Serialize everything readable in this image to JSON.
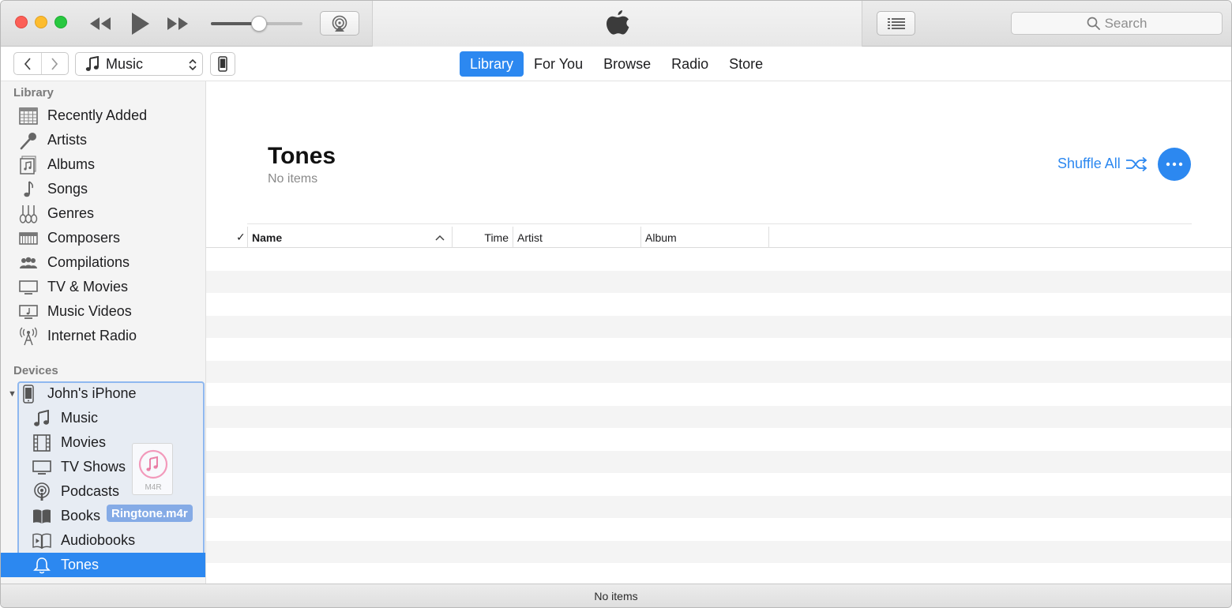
{
  "titlebar": {
    "search_placeholder": "Search"
  },
  "navbar": {
    "media_kind": "Music",
    "tabs": [
      {
        "label": "Library",
        "active": true
      },
      {
        "label": "For You",
        "active": false
      },
      {
        "label": "Browse",
        "active": false
      },
      {
        "label": "Radio",
        "active": false
      },
      {
        "label": "Store",
        "active": false
      }
    ]
  },
  "sidebar": {
    "library_heading": "Library",
    "library_items": [
      {
        "label": "Recently Added",
        "icon": "grid-calendar-icon"
      },
      {
        "label": "Artists",
        "icon": "microphone-icon"
      },
      {
        "label": "Albums",
        "icon": "album-icon"
      },
      {
        "label": "Songs",
        "icon": "music-note-icon"
      },
      {
        "label": "Genres",
        "icon": "guitars-icon"
      },
      {
        "label": "Composers",
        "icon": "piano-icon"
      },
      {
        "label": "Compilations",
        "icon": "people-icon"
      },
      {
        "label": "TV & Movies",
        "icon": "tv-icon"
      },
      {
        "label": "Music Videos",
        "icon": "music-video-icon"
      },
      {
        "label": "Internet Radio",
        "icon": "antenna-icon"
      }
    ],
    "devices_heading": "Devices",
    "device_name": "John's iPhone",
    "device_items": [
      {
        "label": "Music",
        "icon": "music-note-icon"
      },
      {
        "label": "Movies",
        "icon": "film-icon"
      },
      {
        "label": "TV Shows",
        "icon": "tv-icon"
      },
      {
        "label": "Podcasts",
        "icon": "podcast-icon"
      },
      {
        "label": "Books",
        "icon": "book-icon"
      },
      {
        "label": "Audiobooks",
        "icon": "audiobook-icon"
      },
      {
        "label": "Tones",
        "icon": "bell-icon",
        "selected": true
      }
    ],
    "drag_file_ext": "M4R",
    "drag_file_name": "Ringtone.m4r"
  },
  "main": {
    "title": "Tones",
    "subtitle": "No items",
    "shuffle_label": "Shuffle All",
    "columns": {
      "check": "✓",
      "name": "Name",
      "time": "Time",
      "artist": "Artist",
      "album": "Album"
    }
  },
  "status": {
    "text": "No items"
  },
  "player": {
    "volume_level": 0.53
  },
  "colors": {
    "accent": "#2c88f0",
    "sidebar_bg": "#f4f4f4",
    "stripe": "#f4f4f4"
  }
}
